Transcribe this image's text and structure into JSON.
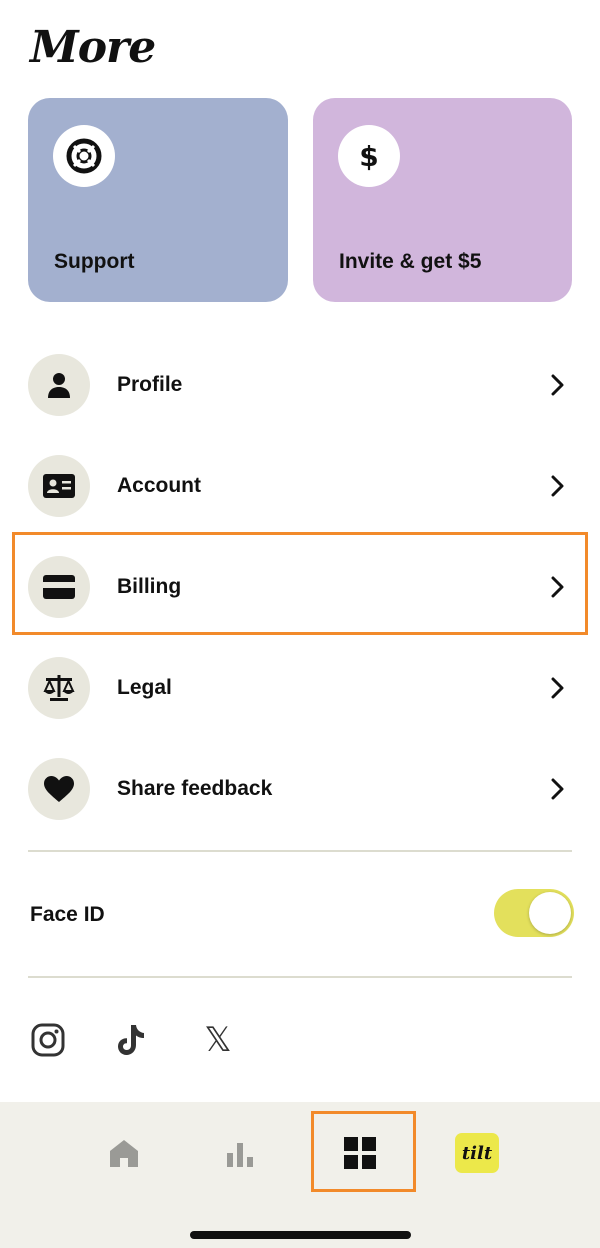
{
  "header": {
    "title": "More"
  },
  "cards": {
    "support": {
      "label": "Support",
      "icon": "lifebuoy-icon",
      "color": "#a3b0cf"
    },
    "invite": {
      "label": "Invite & get $5",
      "icon_glyph": "$",
      "icon": "dollar-icon",
      "color": "#d1b6dc"
    }
  },
  "menu": [
    {
      "label": "Profile",
      "icon": "person-icon"
    },
    {
      "label": "Account",
      "icon": "id-card-icon"
    },
    {
      "label": "Billing",
      "icon": "credit-card-icon"
    },
    {
      "label": "Legal",
      "icon": "scales-icon"
    },
    {
      "label": "Share feedback",
      "icon": "heart-icon"
    }
  ],
  "settings": {
    "face_id_label": "Face ID",
    "face_id_enabled": true,
    "toggle_color": "#e3e05c"
  },
  "social": {
    "x_glyph": "𝕏",
    "icons": [
      "instagram-icon",
      "tiktok-icon",
      "x-icon"
    ]
  },
  "tabbar": {
    "tabs": [
      "home-icon",
      "stats-icon",
      "grid-icon",
      "tilt-logo"
    ],
    "active": "grid-icon",
    "logo_text": "tilt"
  },
  "colors": {
    "highlight": "#f28a2a",
    "icon_bg": "#e8e7dd",
    "tabbar_bg": "#f1f0ea"
  }
}
